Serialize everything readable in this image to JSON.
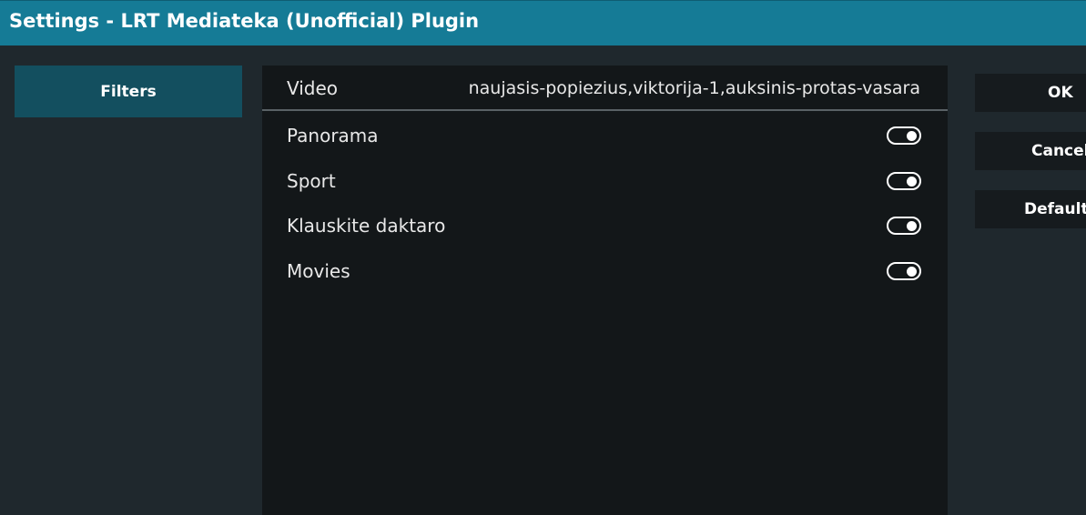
{
  "window": {
    "title": "Settings - LRT Mediateka (Unofficial) Plugin"
  },
  "categories": [
    {
      "label": "Filters",
      "selected": true
    }
  ],
  "settings": {
    "video": {
      "label": "Video",
      "value": "naujasis-popiezius,viktorija-1,auksinis-protas-vasara"
    },
    "toggles": [
      {
        "label": "Panorama",
        "enabled": true
      },
      {
        "label": "Sport",
        "enabled": true
      },
      {
        "label": "Klauskite daktaro",
        "enabled": true
      },
      {
        "label": "Movies",
        "enabled": true
      }
    ]
  },
  "actions": {
    "ok": "OK",
    "cancel": "Cancel",
    "defaults": "Defaults"
  },
  "colors": {
    "title_bar": "#157b96",
    "selected_category": "#134f5f",
    "background": "#1f282d",
    "panel": "#131719"
  }
}
